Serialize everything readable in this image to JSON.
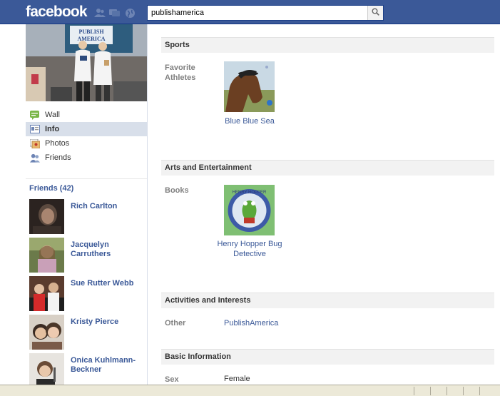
{
  "header": {
    "logo": "facebook",
    "search": {
      "value": "publishamerica",
      "placeholder": ""
    }
  },
  "profile": {
    "photo_banner_text": "Publish America"
  },
  "nav": {
    "items": [
      {
        "label": "Wall",
        "icon": "wall-icon"
      },
      {
        "label": "Info",
        "icon": "info-icon",
        "active": true
      },
      {
        "label": "Photos",
        "icon": "photos-icon"
      },
      {
        "label": "Friends",
        "icon": "friends-icon"
      }
    ]
  },
  "friends": {
    "title": "Friends (42)",
    "list": [
      {
        "name": "Rich Carlton"
      },
      {
        "name": "Jacquelyn Carruthers"
      },
      {
        "name": "Sue Rutter Webb"
      },
      {
        "name": "Kristy Pierce"
      },
      {
        "name": "Onica Kuhlmann-Beckner"
      }
    ]
  },
  "info": {
    "sections": [
      {
        "title": "Sports",
        "rows": [
          {
            "label": "Favorite Athletes",
            "items": [
              "Blue Blue Sea"
            ]
          }
        ]
      },
      {
        "title": "Arts and Entertainment",
        "rows": [
          {
            "label": "Books",
            "items": [
              "Henry Hopper Bug Detective"
            ]
          }
        ]
      },
      {
        "title": "Activities and Interests",
        "rows": [
          {
            "label": "Other",
            "items": [
              "PublishAmerica"
            ]
          }
        ]
      },
      {
        "title": "Basic Information",
        "rows": [
          {
            "label": "Sex",
            "value": "Female"
          }
        ]
      }
    ],
    "book_cover_text": "HENRY HOPPER"
  },
  "colors": {
    "brand_blue": "#3b5998",
    "header_border": "#133783",
    "section_bg": "#f2f2f2",
    "active_nav_bg": "#d8dfea"
  }
}
